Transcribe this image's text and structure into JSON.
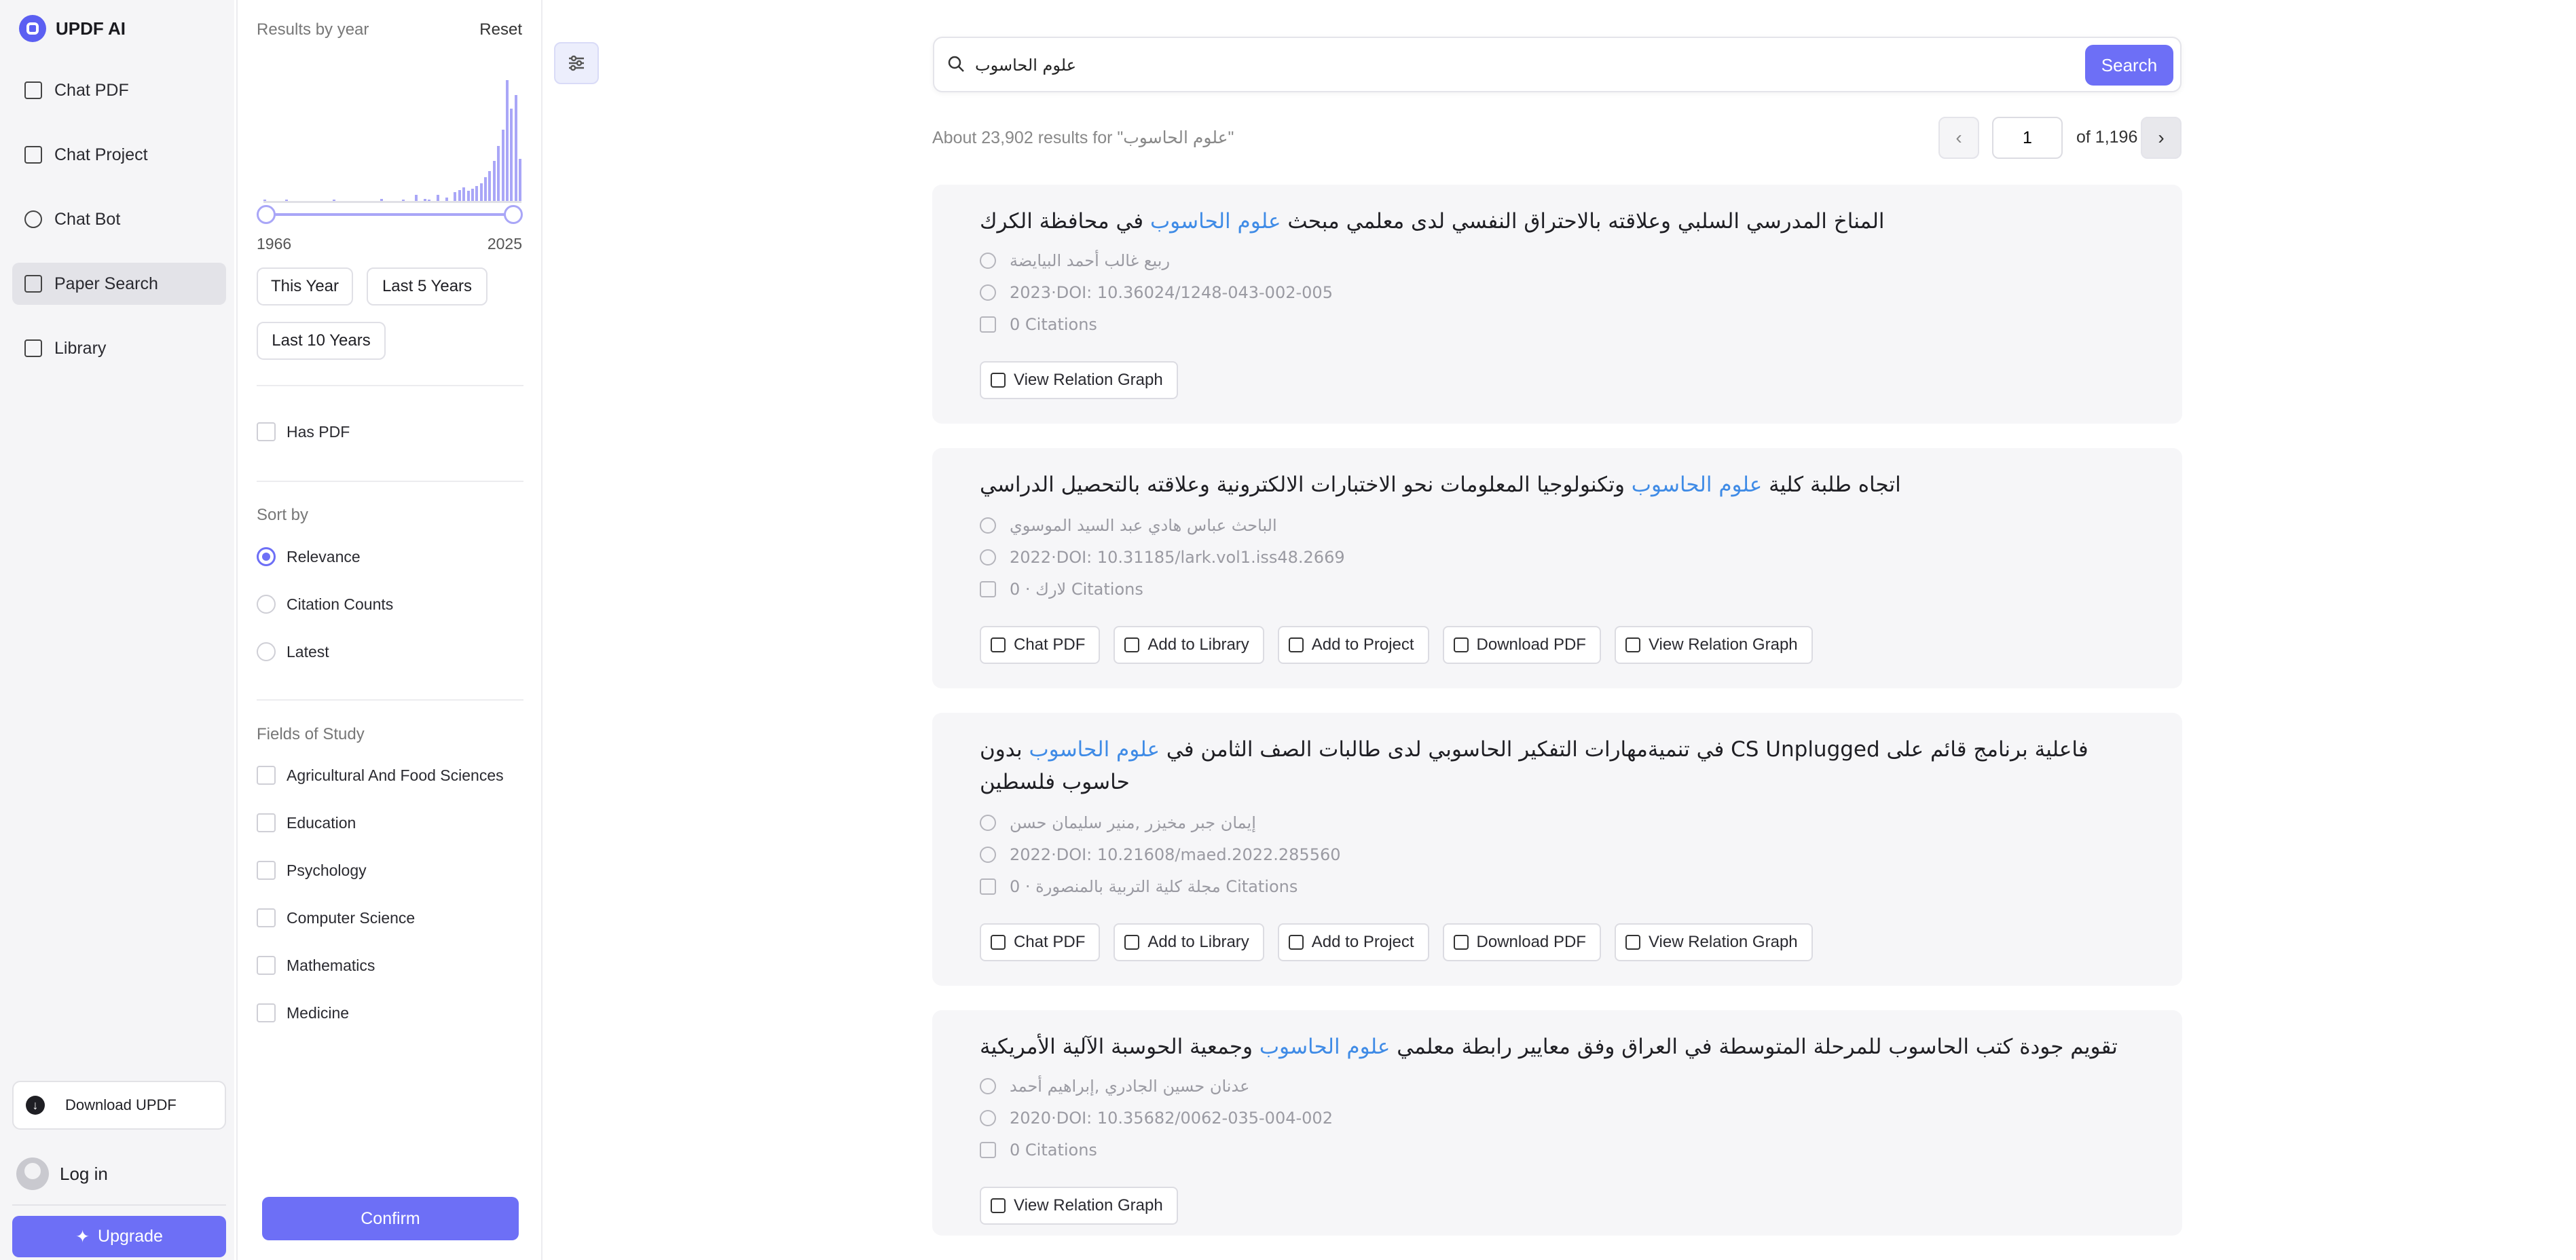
{
  "app": {
    "title": "UPDF AI"
  },
  "sidebar": {
    "items": [
      {
        "label": "Chat PDF",
        "icon": "chat-pdf-icon"
      },
      {
        "label": "Chat Project",
        "icon": "chat-project-icon"
      },
      {
        "label": "Chat Bot",
        "icon": "chat-bot-icon"
      },
      {
        "label": "Paper Search",
        "icon": "paper-search-icon",
        "active": true
      },
      {
        "label": "Library",
        "icon": "library-icon"
      }
    ],
    "download_label": "Download UPDF",
    "login_label": "Log in",
    "upgrade_label": "Upgrade"
  },
  "filters": {
    "results_by_year_label": "Results by year",
    "reset_label": "Reset",
    "year_min": "1966",
    "year_max": "2025",
    "histogram": [
      {
        "year": 1966,
        "value": 2
      },
      {
        "year": 1971,
        "value": 2
      },
      {
        "year": 1982,
        "value": 2
      },
      {
        "year": 1993,
        "value": 3
      },
      {
        "year": 1998,
        "value": 2
      },
      {
        "year": 2001,
        "value": 6
      },
      {
        "year": 2003,
        "value": 3
      },
      {
        "year": 2004,
        "value": 2
      },
      {
        "year": 2006,
        "value": 6
      },
      {
        "year": 2008,
        "value": 4
      },
      {
        "year": 2010,
        "value": 8
      },
      {
        "year": 2011,
        "value": 10
      },
      {
        "year": 2012,
        "value": 12
      },
      {
        "year": 2013,
        "value": 9
      },
      {
        "year": 2014,
        "value": 11
      },
      {
        "year": 2015,
        "value": 13
      },
      {
        "year": 2016,
        "value": 15
      },
      {
        "year": 2017,
        "value": 20
      },
      {
        "year": 2018,
        "value": 25
      },
      {
        "year": 2019,
        "value": 33
      },
      {
        "year": 2020,
        "value": 45
      },
      {
        "year": 2021,
        "value": 58
      },
      {
        "year": 2022,
        "value": 98
      },
      {
        "year": 2023,
        "value": 75
      },
      {
        "year": 2024,
        "value": 86
      },
      {
        "year": 2025,
        "value": 35
      }
    ],
    "quick_ranges": [
      "This Year",
      "Last 5 Years",
      "Last 10 Years"
    ],
    "has_pdf_label": "Has PDF",
    "sort_by_label": "Sort by",
    "sort_options": [
      "Relevance",
      "Citation Counts",
      "Latest"
    ],
    "sort_selected": "Relevance",
    "fields_label": "Fields of Study",
    "fields": [
      "Agricultural And Food Sciences",
      "Education",
      "Psychology",
      "Computer Science",
      "Mathematics",
      "Medicine"
    ],
    "confirm_label": "Confirm"
  },
  "search": {
    "query": "علوم الحاسوب",
    "button_label": "Search",
    "results_text": "About 23,902 results for \"علوم الحاسوب\""
  },
  "pagination": {
    "page": "1",
    "of_text": "of 1,196"
  },
  "results": [
    {
      "title_before": "المناخ المدرسي السلبي وعلاقته بالاحتراق النفسي لدى معلمي مبحث ",
      "title_highlight": "علوم الحاسوب",
      "title_after": " في محافظة الكرك",
      "authors": "ربيع غالب أحمد البيايضة",
      "year_doi": "2023·DOI: 10.36024/1248-043-002-005",
      "citations": "0 Citations",
      "actions": [
        "View Relation Graph"
      ]
    },
    {
      "title_before": "اتجاه طلبة كلية ",
      "title_highlight": "علوم الحاسوب",
      "title_after": " وتكنولوجيا المعلومات نحو الاختبارات الالكترونية وعلاقته بالتحصيل الدراسي",
      "authors": "الباحث عباس هادي عبد السيد الموسوي",
      "year_doi": "2022·DOI: 10.31185/lark.vol1.iss48.2669",
      "citations": "0 · لارك Citations",
      "actions": [
        "Chat PDF",
        "Add to Library",
        "Add to Project",
        "Download PDF",
        "View Relation Graph"
      ]
    },
    {
      "title_before": "فاعلية برنامج قائم على CS Unplugged في تنميةمهارات التفكير الحاسوبي لدى طالبات الصف الثامن في ",
      "title_highlight": "علوم الحاسوب",
      "title_after": " بدون حاسوب فلسطين",
      "authors": "إيمان جبر مخيزر ,منير سليمان حسن",
      "year_doi": "2022·DOI: 10.21608/maed.2022.285560",
      "citations": "0 · مجلة كلية التربية بالمنصورة Citations",
      "actions": [
        "Chat PDF",
        "Add to Library",
        "Add to Project",
        "Download PDF",
        "View Relation Graph"
      ]
    },
    {
      "title_before": "تقويم جودة كتب الحاسوب للمرحلة المتوسطة في العراق وفق معايير رابطة معلمي ",
      "title_highlight": "علوم الحاسوب",
      "title_after": " وجمعية الحوسبة الآلية الأمريكية",
      "authors": "عدنان حسين الجادري ,إبراهيم أحمد",
      "year_doi": "2020·DOI: 10.35682/0062-035-004-002",
      "citations": "0 Citations",
      "actions": [
        "View Relation Graph"
      ]
    }
  ],
  "colors": {
    "accent": "#6d6ff6",
    "highlight": "#3f8be6",
    "histogram": "#a9a6f7"
  }
}
